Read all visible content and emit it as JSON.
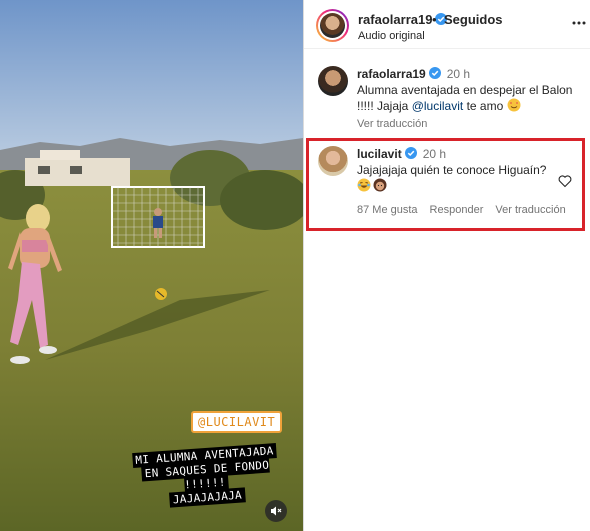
{
  "video": {
    "tag_user": "@LUCILAVIT",
    "caption_lines": [
      "MI ALUMNA AVENTAJADA",
      "EN SAQUES DE FONDO !!!!!!",
      "JAJAJAJAJA"
    ],
    "mute_icon": "speaker-muted-icon"
  },
  "header": {
    "username": "rafaolarra19",
    "separator": "•",
    "follow_status": "Seguidos",
    "audio": "Audio original",
    "more_icon": "more-horizontal-icon"
  },
  "post_comment": {
    "username": "rafaolarra19",
    "time": "20 h",
    "text_before": "Alumna aventajada en despejar el Balon !!!!! Jajaja ",
    "mention": "@lucilavit",
    "text_after": " te amo ",
    "emoji": "smiling-face-with-hearts",
    "translate": "Ver traducción"
  },
  "reply_comment": {
    "username": "lucilavit",
    "time": "20 h",
    "text": "Jajajajaja quién te conoce Higuaín?",
    "emojis": [
      "laughing-tears",
      "woman-hands-on-face"
    ],
    "likes": "87 Me gusta",
    "reply": "Responder",
    "translate": "Ver traducción"
  },
  "colors": {
    "highlight": "#d8232a",
    "verified": "#3897f0",
    "link": "#00376b"
  }
}
